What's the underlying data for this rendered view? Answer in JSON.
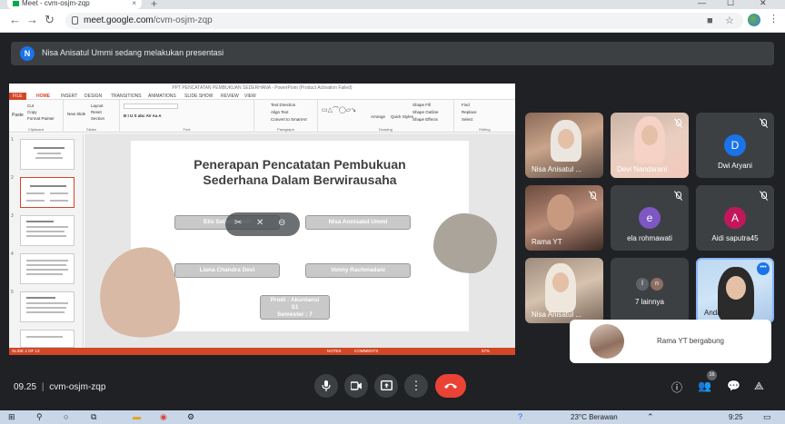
{
  "browser": {
    "tab_title": "Meet - cvm-osjm-zqp",
    "tab_close": "×",
    "new_tab": "+",
    "url_domain": "meet.google.com",
    "url_path": "/cvm-osjm-zqp",
    "window_minimize": "—",
    "window_maximize": "☐",
    "window_close": "✕"
  },
  "notice": {
    "avatar_letter": "N",
    "text": "Nisa Anisatul Ummi sedang melakukan presentasi"
  },
  "ppt": {
    "title_bar": "PPT PENCATATAN PEMBUKUAN SEDERHANA - PowerPoint (Product Activation Failed)",
    "tabs": [
      "FILE",
      "HOME",
      "INSERT",
      "DESIGN",
      "TRANSITIONS",
      "ANIMATIONS",
      "SLIDE SHOW",
      "REVIEW",
      "VIEW"
    ],
    "ribbon": {
      "paste": "Paste",
      "cut": "Cut",
      "copy": "Copy",
      "format_painter": "Format Painter",
      "new_slide": "New Slide",
      "layout": "Layout",
      "reset": "Reset",
      "section": "Section",
      "text_direction": "Text Direction",
      "align_text": "Align Text",
      "convert_smartart": "Convert to SmartArt",
      "arrange": "Arrange",
      "quick_styles": "Quick Styles",
      "shape_fill": "Shape Fill",
      "shape_outline": "Shape Outline",
      "shape_effects": "Shape Effects",
      "find": "Find",
      "replace": "Replace",
      "select": "Select",
      "group_clipboard": "Clipboard",
      "group_slides": "Slides",
      "group_font": "Font",
      "group_paragraph": "Paragraph",
      "group_drawing": "Drawing",
      "group_editing": "Editing"
    },
    "thumbnail_numbers": [
      "1",
      "2",
      "3",
      "4",
      "5"
    ],
    "slide": {
      "title_line1": "Penerapan Pencatatan Pembukuan",
      "title_line2": "Sederhana Dalam Berwirausaha",
      "names": [
        "Elis Setianingsih",
        "Nisa Annisatul Ummi",
        "Liana Chandra Devi",
        "Vonny Rachmadani"
      ],
      "prodi_line1": "Prodi : Akuntansi",
      "prodi_line2": "S1",
      "prodi_line3": "Semester : 7"
    },
    "status": {
      "slide_info": "SLIDE 2 OF 13",
      "notes": "NOTES",
      "comments": "COMMENTS",
      "zoom": "97%"
    }
  },
  "participants": [
    {
      "name": "Nisa Anisatul ...",
      "type": "video",
      "muted": false
    },
    {
      "name": "Devi Nandarani",
      "type": "video",
      "muted": true
    },
    {
      "name": "Dwi Aryani",
      "type": "avatar",
      "letter": "D",
      "color": "#1a73e8",
      "muted": true
    },
    {
      "name": "Rama YT",
      "type": "video",
      "muted": true
    },
    {
      "name": "ela rohmawati",
      "type": "avatar",
      "letter": "e",
      "color": "#7e57c2",
      "muted": true
    },
    {
      "name": "Aidi saputra45",
      "type": "avatar",
      "letter": "A",
      "color": "#c2185b",
      "muted": true
    },
    {
      "name": "Nisa Anisatul ...",
      "type": "video",
      "muted": false
    },
    {
      "name": "7 lainnya",
      "type": "others",
      "letters": [
        "l",
        "n"
      ]
    },
    {
      "name": "Anda",
      "type": "video",
      "muted": false
    }
  ],
  "toast": {
    "text": "Rama YT bergabung"
  },
  "callbar": {
    "time": "09.25",
    "separator": "|",
    "meeting_code": "cvm-osjm-zqp",
    "participant_count": "16"
  },
  "taskbar": {
    "weather": "23°C  Berawan",
    "clock": "9:25"
  },
  "colors": {
    "meet_bg": "#202124",
    "tile_bg": "#3c4043",
    "hangup": "#ea4335",
    "ppt_accent": "#d24726",
    "presenter_blue": "#1a73e8"
  }
}
